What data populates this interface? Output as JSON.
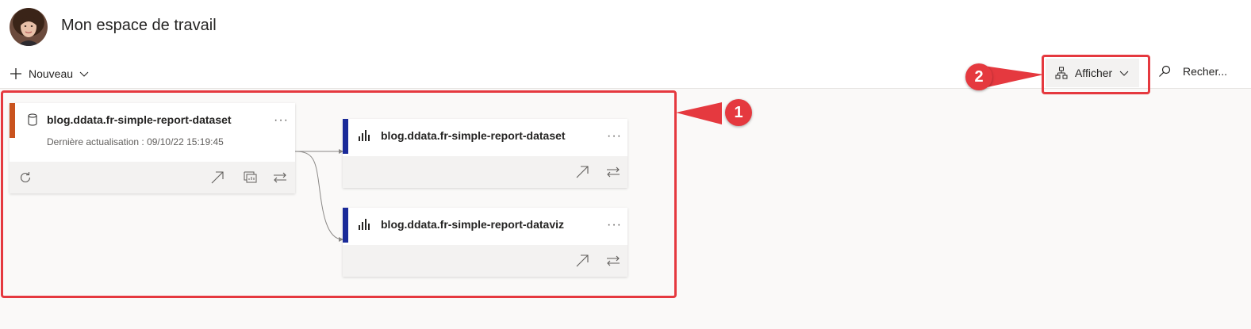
{
  "header": {
    "title": "Mon espace de travail",
    "avatar_icon": "user-avatar"
  },
  "toolbar": {
    "new_label": "Nouveau",
    "view_label": "Afficher",
    "search_label": "Recher..."
  },
  "lineage": {
    "source": {
      "name": "blog.ddata.fr-simple-report-dataset",
      "subtitle": "Dernière actualisation : 09/10/22 15:19:45",
      "type_icon": "dataset-icon",
      "accent": "#c9531e",
      "more": "..."
    },
    "targets": [
      {
        "name": "blog.ddata.fr-simple-report-dataset",
        "type_icon": "report-icon",
        "accent": "#1a2a99",
        "more": "..."
      },
      {
        "name": "blog.ddata.fr-simple-report-dataviz",
        "type_icon": "report-icon",
        "accent": "#1a2a99",
        "more": "..."
      }
    ]
  },
  "annotations": {
    "box1_label": "1",
    "box2_label": "2",
    "color": "#e5393f"
  }
}
